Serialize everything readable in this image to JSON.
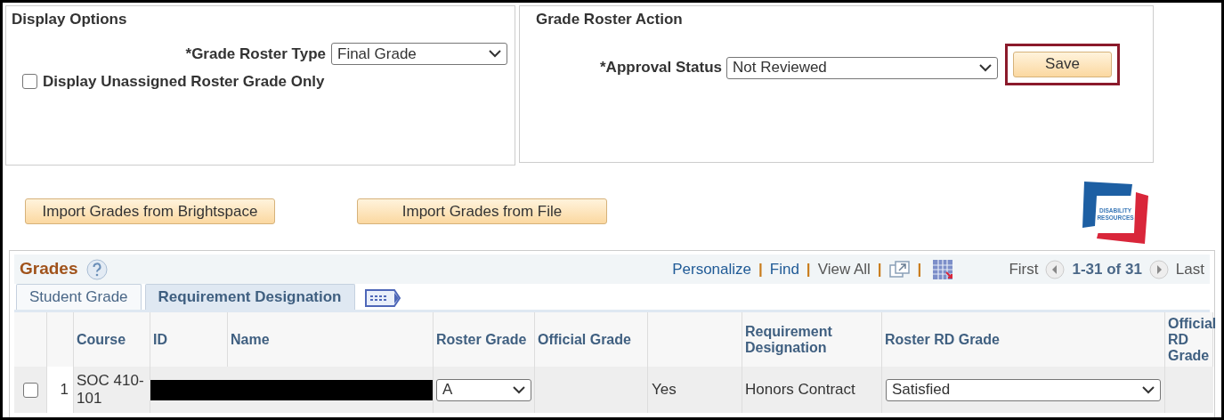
{
  "display_options": {
    "title": "Display Options",
    "grade_roster_type": {
      "label": "*Grade Roster Type",
      "value": "Final Grade"
    },
    "unassigned_only": {
      "label": "Display Unassigned Roster Grade Only",
      "checked": false
    }
  },
  "grade_roster_action": {
    "title": "Grade Roster Action",
    "approval_status": {
      "label": "*Approval Status",
      "value": "Not Reviewed"
    },
    "save_button": {
      "label": "Save",
      "highlighted": true
    }
  },
  "import_buttons": [
    "Import Grades from Brightspace",
    "Import Grades from File"
  ],
  "logo": {
    "lines": [
      "DISABILITY",
      "RESOURCES"
    ]
  },
  "grades": {
    "title": "Grades",
    "toolbar": {
      "separator": "|",
      "links": [
        {
          "label": "Personalize",
          "kind": "link"
        },
        {
          "label": "Find",
          "kind": "link"
        },
        {
          "label": "View All",
          "kind": "plain"
        }
      ],
      "first": "First",
      "range": "1-31 of 31",
      "last": "Last"
    },
    "tabs": [
      {
        "label": "Student Grade",
        "selected": false
      },
      {
        "label": "Requirement Designation",
        "selected": true
      }
    ],
    "columns": [
      {
        "kind": "label",
        "label": "Course"
      },
      {
        "kind": "label",
        "label": "ID"
      },
      {
        "kind": "label",
        "label": "Name"
      },
      {
        "kind": "label",
        "label": "Roster Grade"
      },
      {
        "kind": "label",
        "label": "Official Grade"
      },
      {
        "kind": "blank"
      },
      {
        "kind": "label",
        "label": "Requirement Designation"
      },
      {
        "kind": "label",
        "label": "Roster RD Grade"
      },
      {
        "kind": "label",
        "label": "Official RD Grade"
      }
    ],
    "rows": [
      {
        "checked": false,
        "number": "1",
        "course": "SOC 410-101",
        "redacted": true,
        "roster_grade": "A",
        "column_8": "Yes",
        "requirement_designation": "Honors Contract",
        "roster_rd_grade": "Satisfied"
      }
    ]
  }
}
